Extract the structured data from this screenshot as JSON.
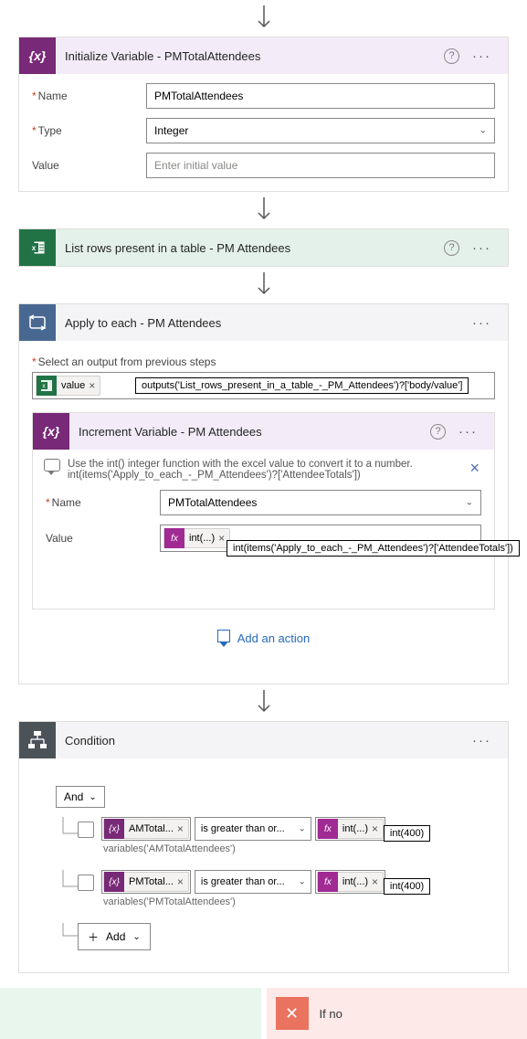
{
  "initVar": {
    "title": "Initialize Variable - PMTotalAttendees",
    "badge": "{x}",
    "fields": {
      "nameLabel": "Name",
      "nameValue": "PMTotalAttendees",
      "typeLabel": "Type",
      "typeValue": "Integer",
      "valueLabel": "Value",
      "valuePlaceholder": "Enter initial value"
    }
  },
  "listRows": {
    "title": "List rows present in a table - PM Attendees"
  },
  "applyEach": {
    "title": "Apply to each - PM Attendees",
    "selectLabel": "Select an output from previous steps",
    "valueToken": "value",
    "valueTooltip": "outputs('List_rows_present_in_a_table_-_PM_Attendees')?['body/value']"
  },
  "increment": {
    "title": "Increment Variable - PM Attendees",
    "badge": "{x}",
    "noteLine1": "Use the int() integer function with the excel value to convert it to a number.",
    "noteLine2": "int(items('Apply_to_each_-_PM_Attendees')?['AttendeeTotals'])",
    "nameLabel": "Name",
    "nameValue": "PMTotalAttendees",
    "valueLabel": "Value",
    "fxToken": "int(...)",
    "fxTooltip": "int(items('Apply_to_each_-_PM_Attendees')?['AttendeeTotals'])",
    "fxBadge": "fx"
  },
  "addAction": "Add an action",
  "condition": {
    "title": "Condition",
    "and": "And",
    "row1": {
      "token": "AMTotal...",
      "subtip": "variables('AMTotalAttendees')",
      "op": "is greater than or...",
      "fx": "int(...)",
      "fxtip": "int(400)"
    },
    "row2": {
      "token": "PMTotal...",
      "subtip": "variables('PMTotalAttendees')",
      "op": "is greater than or...",
      "fx": "int(...)",
      "fxtip": "int(400)"
    },
    "add": "Add",
    "ifno": "If no"
  }
}
